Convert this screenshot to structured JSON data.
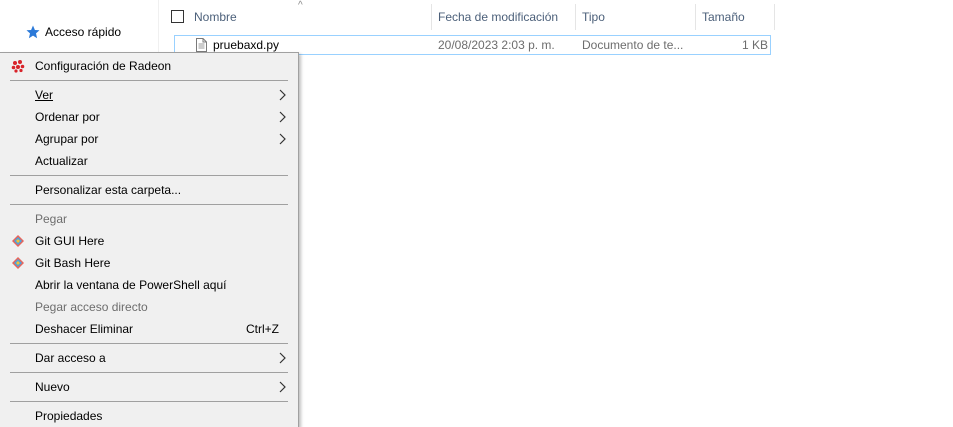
{
  "nav": {
    "quick_access": "Acceso rápido"
  },
  "columns": {
    "name": "Nombre",
    "modified": "Fecha de modificación",
    "type": "Tipo",
    "size": "Tamaño"
  },
  "file": {
    "name": "pruebaxd.py",
    "modified": "20/08/2023 2:03 p. m.",
    "type": "Documento de te...",
    "size": "1 KB"
  },
  "menu": {
    "radeon": "Configuración de Radeon",
    "view": "Ver",
    "sort_by": "Ordenar por",
    "group_by": "Agrupar por",
    "refresh": "Actualizar",
    "customize": "Personalizar esta carpeta...",
    "paste": "Pegar",
    "git_gui": "Git GUI Here",
    "git_bash": "Git Bash Here",
    "powershell": "Abrir la ventana de PowerShell aquí",
    "paste_shortcut": "Pegar acceso directo",
    "undo_delete": "Deshacer Eliminar",
    "undo_delete_shortcut": "Ctrl+Z",
    "give_access": "Dar acceso a",
    "new": "Nuevo",
    "properties": "Propiedades"
  },
  "colors": {
    "menu_bg": "#f0f0f0",
    "selection_border": "#99d1ff",
    "header_text": "#4c607a",
    "disabled_text": "#6d6d6d"
  }
}
